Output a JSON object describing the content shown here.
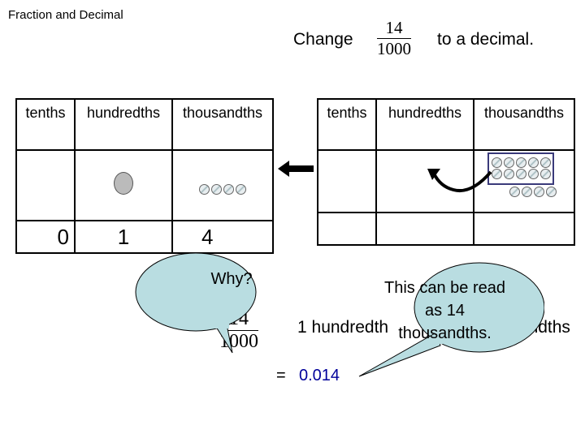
{
  "title": "Fraction and Decimal",
  "question": {
    "prefix": "Change",
    "numerator": "14",
    "denominator": "1000",
    "suffix": "to a decimal."
  },
  "columns": [
    "tenths",
    "hundredths",
    "thousandths"
  ],
  "left_table": {
    "digits": [
      "0",
      "1",
      "4"
    ],
    "hundredths_dots": 1,
    "thousandths_dots": 4
  },
  "right_table": {
    "thousandths_dots": 14,
    "grouped": 10
  },
  "work": {
    "numerator": "14",
    "denominator": "1000",
    "middle": "1 hundredth",
    "end": "4 thousandths",
    "result_prefix": "=",
    "result": "0.014"
  },
  "bubbles": {
    "why": "Why?",
    "read": "This can be read as 14 thousandths."
  },
  "colors": {
    "bubble": "#b9dde1",
    "result": "#00009a",
    "group_box": "#3a3a7a"
  }
}
